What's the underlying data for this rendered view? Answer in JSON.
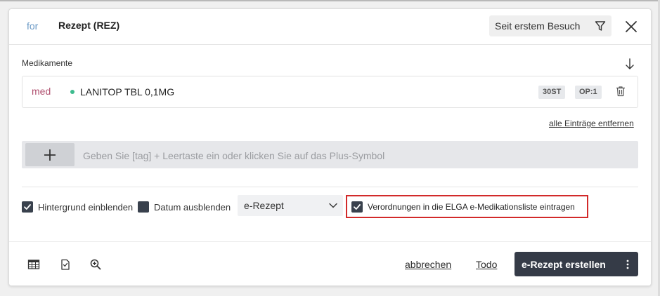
{
  "header": {
    "prefix": "for",
    "title": "Rezept (REZ)",
    "filter_label": "Seit erstem Besuch"
  },
  "medications": {
    "section_label": "Medikamente",
    "items": [
      {
        "tag": "med",
        "name": "LANITOP TBL 0,1MG",
        "badges": [
          "30ST",
          "OP:1"
        ],
        "status_color": "#3dbb8e"
      }
    ],
    "remove_all_label": "alle Einträge entfernen"
  },
  "tag_input": {
    "value": "",
    "placeholder": "Geben Sie [tag] + Leertaste ein oder klicken Sie auf das Plus-Symbol"
  },
  "options": {
    "show_background": {
      "label": "Hintergrund einblenden",
      "checked": true
    },
    "hide_date": {
      "label": "Datum ausblenden",
      "checked": false
    },
    "prescription_type": "e-Rezept",
    "elga": {
      "label": "Verordnungen in die ELGA e-Medikationsliste eintragen",
      "checked": true
    }
  },
  "footer": {
    "icons": [
      "table-icon",
      "clipboard-check-icon",
      "zoom-in-icon"
    ],
    "cancel_label": "abbrechen",
    "todo_label": "Todo",
    "primary_label": "e-Rezept erstellen"
  },
  "colors": {
    "accent_dark": "#353b47",
    "highlight_border": "#d22a2a",
    "tag_color": "#b0506f",
    "prefix_color": "#6b9ac6"
  }
}
